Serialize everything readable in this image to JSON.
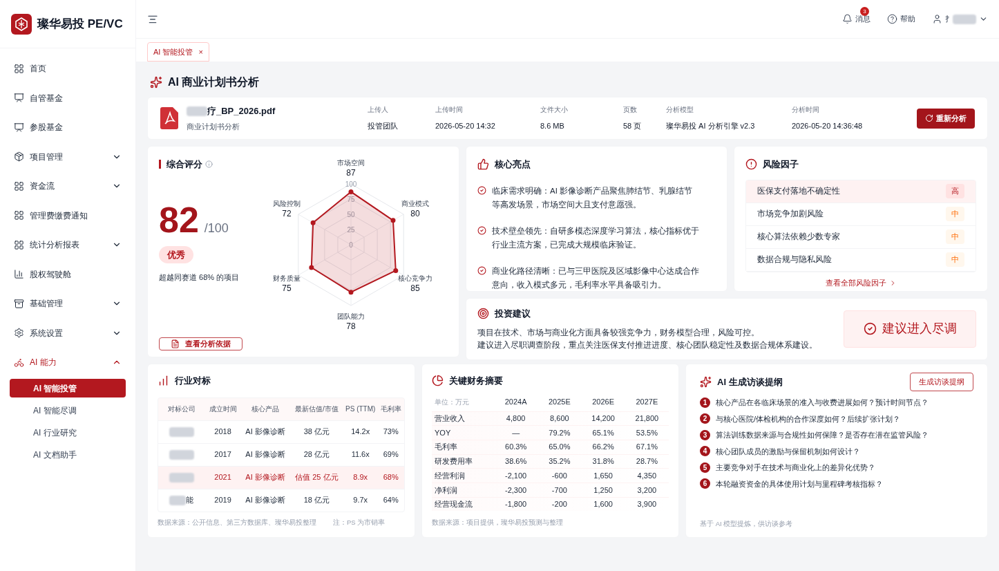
{
  "brand": {
    "name": "璨华易投 PE/VC"
  },
  "header": {
    "items": [
      {
        "kind": "bell",
        "label": "消息",
        "badge": "3"
      },
      {
        "kind": "help",
        "label": "帮助"
      },
      {
        "kind": "user",
        "label": "扌"
      }
    ]
  },
  "sidebar": {
    "items": [
      {
        "label": "首页",
        "expanded": false,
        "selected": false,
        "has_children": false
      },
      {
        "label": "自管基金",
        "expanded": false,
        "selected": false,
        "has_children": false
      },
      {
        "label": "参股基金",
        "expanded": false,
        "selected": false,
        "has_children": false
      },
      {
        "label": "项目管理",
        "expanded": false,
        "selected": false,
        "has_children": true
      },
      {
        "label": "资金流",
        "expanded": false,
        "selected": false,
        "has_children": true
      },
      {
        "label": "管理费缴费通知",
        "expanded": false,
        "selected": false,
        "has_children": false
      },
      {
        "label": "统计分析报表",
        "expanded": false,
        "selected": false,
        "has_children": true
      },
      {
        "label": "股权驾驶舱",
        "expanded": false,
        "selected": false,
        "has_children": false
      },
      {
        "label": "基础管理",
        "expanded": false,
        "selected": false,
        "has_children": true
      },
      {
        "label": "系统设置",
        "expanded": false,
        "selected": false,
        "has_children": true
      },
      {
        "label": "AI 能力",
        "expanded": true,
        "selected": false,
        "has_children": true,
        "children": [
          {
            "label": "AI 智能投管",
            "selected": true
          },
          {
            "label": "AI 智能尽调",
            "selected": false
          },
          {
            "label": "AI 行业研究",
            "selected": false
          },
          {
            "label": "AI 文档助手",
            "selected": false
          }
        ]
      }
    ]
  },
  "tabs": [
    {
      "label": "AI 智能投管",
      "selected": true,
      "close": "×"
    }
  ],
  "page_title": "AI 商业计划书分析",
  "file": {
    "name": "疗_BP_2026.pdf",
    "subtitle": "商业计划书分析",
    "fields": [
      {
        "label": "上传人",
        "value": "投管团队"
      },
      {
        "label": "上传时间",
        "value": "2026-05-20 14:32"
      },
      {
        "label": "文件大小",
        "value": "8.6 MB"
      },
      {
        "label": "页数",
        "value": "58 页"
      },
      {
        "label": "分析模型",
        "value": "璨华易投 AI 分析引擎 v2.3"
      },
      {
        "label": "分析时间",
        "value": "2026-05-20 14:36:48"
      }
    ],
    "button": "重新分析"
  },
  "score": {
    "title": "综合评分",
    "value": "82",
    "max": "/100",
    "grade": "优秀",
    "note": "超越同赛道 68% 的项目",
    "button": "查看分析依据",
    "radar": {
      "ticks": [
        "100",
        "75",
        "50",
        "25",
        "0"
      ],
      "axes": [
        {
          "label": "市场空间",
          "value": "87"
        },
        {
          "label": "风险控制",
          "value": "72"
        },
        {
          "label": "商业模式",
          "value": "80"
        },
        {
          "label": "财务质量",
          "value": "75"
        },
        {
          "label": "核心竞争力",
          "value": "85"
        },
        {
          "label": "团队能力",
          "value": "78"
        }
      ]
    }
  },
  "highlights": {
    "title": "核心亮点",
    "items": [
      "临床需求明确：AI 影像诊断产品聚焦肺结节、乳腺结节等高发场景，市场空间大且支付意愿强。",
      "技术壁垒领先：自研多模态深度学习算法，核心指标优于行业主流方案，已完成大规模临床验证。",
      "商业化路径清晰：已与三甲医院及区域影像中心达成合作意向，收入模式多元，毛利率水平具备吸引力。"
    ]
  },
  "risks": {
    "title": "风险因子",
    "items": [
      {
        "label": "医保支付落地不确定性",
        "level_text": "高",
        "kind": "high"
      },
      {
        "label": "市场竞争加剧风险",
        "level_text": "中",
        "kind": "medium"
      },
      {
        "label": "核心算法依赖少数专家",
        "level_text": "中",
        "kind": "medium"
      },
      {
        "label": "数据合规与隐私风险",
        "level_text": "中",
        "kind": "medium"
      }
    ],
    "link": "查看全部风险因子"
  },
  "advice": {
    "title": "投资建议",
    "lines": [
      "项目在技术、市场与商业化方面具备较强竞争力，财务模型合理，风险可控。",
      "建议进入尽职调查阶段，重点关注医保支付推进进度、核心团队稳定性及数据合规体系建设。"
    ],
    "verdict": "建议进入尽调"
  },
  "benchmark": {
    "title": "行业对标",
    "columns": [
      "对标公司",
      "成立时间",
      "核心产品",
      "最新估值/市值",
      "PS (TTM)",
      "毛利率"
    ],
    "rows": [
      {
        "selected": false,
        "cells": [
          "",
          "2018",
          "AI 影像诊断",
          "38 亿元",
          "14.2x",
          "73%"
        ]
      },
      {
        "selected": false,
        "cells": [
          "",
          "2017",
          "AI 影像诊断",
          "28 亿元",
          "11.6x",
          "69%"
        ]
      },
      {
        "selected": true,
        "cells": [
          "",
          "2021",
          "AI 影像诊断",
          "估值 25 亿元",
          "8.9x",
          "68%"
        ]
      },
      {
        "selected": false,
        "cells": [
          "能",
          "2019",
          "AI 影像诊断",
          "18 亿元",
          "9.7x",
          "64%"
        ]
      }
    ],
    "footnote": "数据来源：公开信息、第三方数据库、璨华易投整理",
    "note": "注：PS 为市销率"
  },
  "financials": {
    "title": "关键财务摘要",
    "columns": [
      "单位：万元",
      "2024A",
      "2025E",
      "2026E",
      "2027E"
    ],
    "rows": [
      [
        "营业收入",
        "4,800",
        "8,600",
        "14,200",
        "21,800"
      ],
      [
        "YOY",
        "—",
        "79.2%",
        "65.1%",
        "53.5%"
      ],
      [
        "毛利率",
        "60.3%",
        "65.0%",
        "66.2%",
        "67.1%"
      ],
      [
        "研发费用率",
        "38.6%",
        "35.2%",
        "31.8%",
        "28.7%"
      ],
      [
        "经营利润",
        "-2,100",
        "-600",
        "1,650",
        "4,350"
      ],
      [
        "净利润",
        "-2,300",
        "-700",
        "1,250",
        "3,200"
      ],
      [
        "经营现金流",
        "-1,800",
        "-200",
        "1,600",
        "3,900"
      ]
    ],
    "footnote": "数据来源：项目提供，璨华易投预测与整理"
  },
  "interview": {
    "title": "AI 生成访谈提纲",
    "button": "生成访谈提纲",
    "items": [
      {
        "n": "1",
        "text": "核心产品在各临床场景的准入与收费进展如何？预计时间节点？"
      },
      {
        "n": "2",
        "text": "与核心医院/体检机构的合作深度如何？后续扩张计划？"
      },
      {
        "n": "3",
        "text": "算法训练数据来源与合规性如何保障？是否存在潜在监管风险？"
      },
      {
        "n": "4",
        "text": "核心团队成员的激励与保留机制如何设计？"
      },
      {
        "n": "5",
        "text": "主要竞争对手在技术与商业化上的差异化优势？"
      },
      {
        "n": "6",
        "text": "本轮融资资金的具体使用计划与里程碑考核指标？"
      }
    ],
    "footnote": "基于 AI 模型提炼，供访谈参考"
  }
}
